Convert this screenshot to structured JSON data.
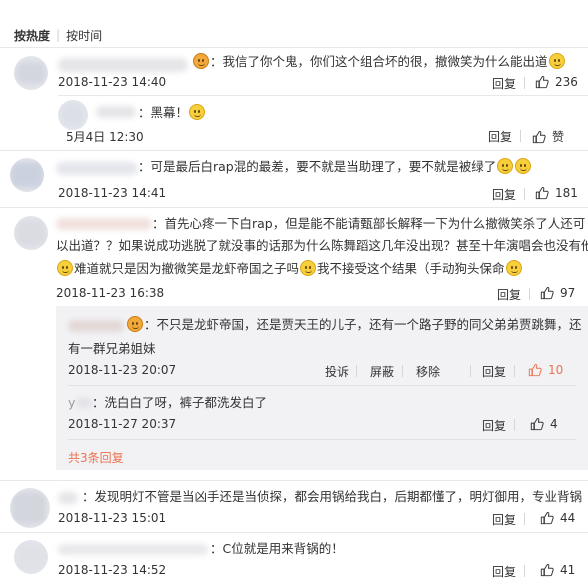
{
  "sort": {
    "hot_label": "按热度",
    "time_label": "按时间"
  },
  "comments": [
    {
      "text": "：我信了你个鬼，你们这个组合坏的很，撤微笑为什么能出道",
      "time": "2018-11-23 14:40",
      "reply": "回复",
      "likes": "236"
    },
    {
      "text": "：黑幕！",
      "time": "5月4日 12:30",
      "reply": "回复",
      "likes": "赞"
    },
    {
      "text": "：可是最后白rap混的最差，要不就是当助理了，要不就是被绿了",
      "time": "2018-11-23 14:41",
      "reply": "回复",
      "likes": "181"
    },
    {
      "line1": "：首先心疼一下白rap，但是能不能请甄部长解释一下为什么撤微笑杀了人还可",
      "line2": "以出道？？如果说成功逃脱了就没事的话那为什么陈舞蹈这几年没出现？甚至十年演唱会也没有他",
      "line3a": "难道就只是因为撤微笑是龙虾帝国之子吗",
      "line3b": "我不接受这个结果（手动狗头保命",
      "time": "2018-11-23 16:38",
      "reply": "回复",
      "likes": "97"
    }
  ],
  "replies": [
    {
      "line1": "：不只是龙虾帝国，还是贾天王的儿子，还有一个路子野的同父弟弟贾跳舞，还",
      "line2": "有一群兄弟姐妹",
      "time": "2018-11-23 20:07",
      "report": "投诉",
      "block": "屏蔽",
      "remove": "移除",
      "reply": "回复",
      "likes": "10"
    },
    {
      "user": "y",
      "text": "：洗白白了呀，裤子都洗发白了",
      "time": "2018-11-27 20:37",
      "reply": "回复",
      "likes": "4"
    }
  ],
  "more_replies": "共3条回复",
  "comments2": [
    {
      "text": "：发现明灯不管是当凶手还是当侦探，都会用锅给我白，后期都懂了，明灯御用，专业背锅",
      "time": "2018-11-23 15:01",
      "reply": "回复",
      "likes": "44"
    },
    {
      "text": "：C位就是用来背锅的！",
      "time": "2018-11-23 14:52",
      "reply": "回复",
      "likes": "41"
    }
  ],
  "colors": {
    "accent": "#eb7350",
    "reply_bg": "#f2f2f5",
    "text": "#333333"
  }
}
